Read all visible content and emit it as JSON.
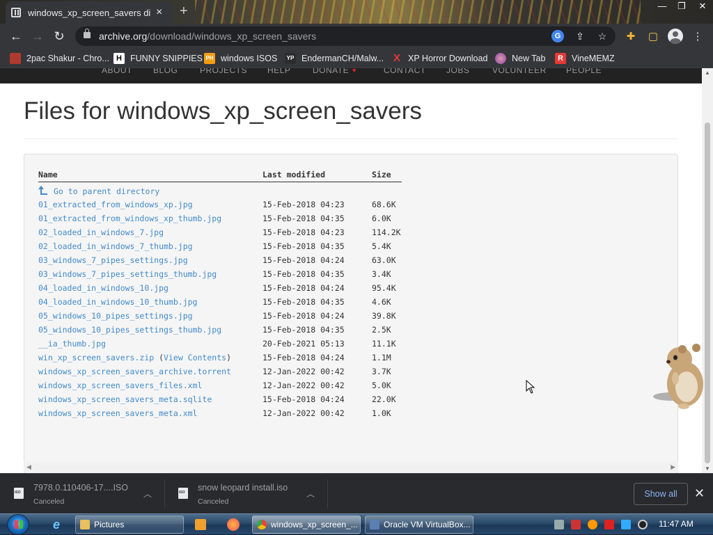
{
  "browser": {
    "tab_title": "windows_xp_screen_savers directory",
    "new_tab_symbol": "+",
    "url_host": "archive.org",
    "url_path": "/download/windows_xp_screen_savers"
  },
  "bookmarks": [
    {
      "label": "2pac Shakur - Chro...",
      "icon": "image-favicon",
      "color": "#c0392b"
    },
    {
      "label": "FUNNY SNIPPIES",
      "icon": "H-favicon",
      "color": "#ffffff"
    },
    {
      "label": "windows ISOS",
      "icon": "PH-favicon",
      "color": "#f39c12"
    },
    {
      "label": "EndermanCH/Malw...",
      "icon": "YP-favicon",
      "color": "#333333"
    },
    {
      "label": "XP Horror Download",
      "icon": "X-favicon",
      "color": "#e53935"
    },
    {
      "label": "New Tab",
      "icon": "globe-favicon",
      "color": "#8e44ad"
    },
    {
      "label": "VineMEMZ",
      "icon": "R-favicon",
      "color": "#e53935"
    }
  ],
  "site_nav": [
    "ABOUT",
    "BLOG",
    "PROJECTS",
    "HELP",
    "DONATE",
    "CONTACT",
    "JOBS",
    "VOLUNTEER",
    "PEOPLE"
  ],
  "page": {
    "title": "Files for windows_xp_screen_savers",
    "columns": {
      "name": "Name",
      "modified": "Last modified",
      "size": "Size"
    },
    "parent_link": "Go to parent directory",
    "files": [
      {
        "name": "01_extracted_from_windows_xp.jpg",
        "modified": "15-Feb-2018 04:23",
        "size": "68.6K"
      },
      {
        "name": "01_extracted_from_windows_xp_thumb.jpg",
        "modified": "15-Feb-2018 04:35",
        "size": "6.0K"
      },
      {
        "name": "02_loaded_in_windows_7.jpg",
        "modified": "15-Feb-2018 04:23",
        "size": "114.2K"
      },
      {
        "name": "02_loaded_in_windows_7_thumb.jpg",
        "modified": "15-Feb-2018 04:35",
        "size": "5.4K"
      },
      {
        "name": "03_windows_7_pipes_settings.jpg",
        "modified": "15-Feb-2018 04:24",
        "size": "63.0K"
      },
      {
        "name": "03_windows_7_pipes_settings_thumb.jpg",
        "modified": "15-Feb-2018 04:35",
        "size": "3.4K"
      },
      {
        "name": "04_loaded_in_windows_10.jpg",
        "modified": "15-Feb-2018 04:24",
        "size": "95.4K"
      },
      {
        "name": "04_loaded_in_windows_10_thumb.jpg",
        "modified": "15-Feb-2018 04:35",
        "size": "4.6K"
      },
      {
        "name": "05_windows_10_pipes_settings.jpg",
        "modified": "15-Feb-2018 04:24",
        "size": "39.8K"
      },
      {
        "name": "05_windows_10_pipes_settings_thumb.jpg",
        "modified": "15-Feb-2018 04:35",
        "size": "2.5K"
      },
      {
        "name": "__ia_thumb.jpg",
        "modified": "20-Feb-2021 05:13",
        "size": "11.1K"
      },
      {
        "name": "win_xp_screen_savers.zip",
        "extra_link": "View Contents",
        "modified": "15-Feb-2018 04:24",
        "size": "1.1M"
      },
      {
        "name": "windows_xp_screen_savers_archive.torrent",
        "modified": "12-Jan-2022 00:42",
        "size": "3.7K"
      },
      {
        "name": "windows_xp_screen_savers_files.xml",
        "modified": "12-Jan-2022 00:42",
        "size": "5.0K"
      },
      {
        "name": "windows_xp_screen_savers_meta.sqlite",
        "modified": "15-Feb-2018 04:24",
        "size": "22.0K"
      },
      {
        "name": "windows_xp_screen_savers_meta.xml",
        "modified": "12-Jan-2022 00:42",
        "size": "1.0K"
      }
    ]
  },
  "downloads": [
    {
      "name": "7978.0.110406-17....ISO",
      "status": "Canceled"
    },
    {
      "name": "snow leopard install.iso",
      "status": "Canceled"
    }
  ],
  "downloads_show_all": "Show all",
  "taskbar": {
    "buttons": [
      {
        "label": "Pictures",
        "icon": "folder-icon"
      },
      {
        "label": "windows_xp_screen_...",
        "icon": "chrome-icon"
      },
      {
        "label": "Oracle VM VirtualBox...",
        "icon": "virtualbox-icon"
      }
    ],
    "clock": "11:47 AM"
  },
  "colors": {
    "link": "#428bca",
    "chrome_dark": "#35363a",
    "show_all_text": "#8ab4f8"
  }
}
